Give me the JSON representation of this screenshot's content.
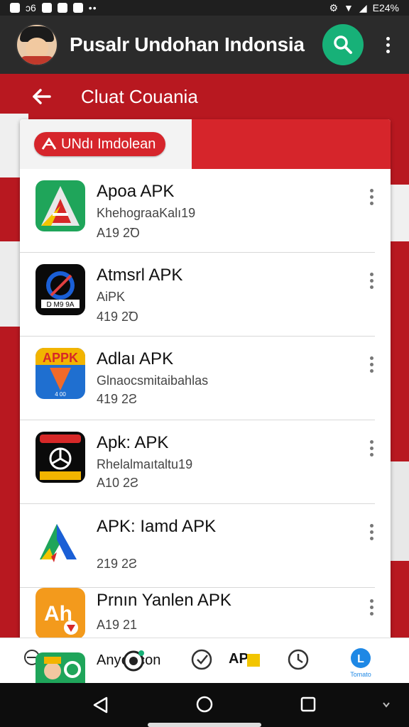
{
  "status_bar": {
    "left_text": "ↄ6",
    "right_text": "E24%"
  },
  "app_bar": {
    "title": "Pusalr Undohan Indonsia"
  },
  "sub_bar": {
    "title": "Cluat Couania"
  },
  "card": {
    "header_pill": "UNdı Imdolean"
  },
  "apps": [
    {
      "name": "Apoa APK",
      "subtitle": "KhehograaKalı19",
      "version": "A19 2Ꝺ"
    },
    {
      "name": "Atmsrl APK",
      "subtitle": "AiPK",
      "version": "419 2Ꝺ"
    },
    {
      "name": "Adlaı APK",
      "subtitle": "Glnaocsmitaibahlas",
      "version": "419 2Ƨ"
    },
    {
      "name": "Apk: APK",
      "subtitle": "Rhelalmaıtaltu19",
      "version": "A10 2Ƨ"
    },
    {
      "name": "APK: Iamd APK",
      "subtitle": "",
      "version": "219 2Ƨ"
    },
    {
      "name": "Prnın Yanlen APK",
      "subtitle": "",
      "version": "A19 21"
    }
  ],
  "bottom_nav": {
    "items": [
      {
        "label": "Anyꞷ con"
      },
      {
        "label": "AP"
      },
      {
        "label": "Tomato"
      }
    ]
  },
  "colors": {
    "brand_red": "#d6252b",
    "accent_green": "#17b178",
    "dark_bar": "#2b2b2b"
  }
}
